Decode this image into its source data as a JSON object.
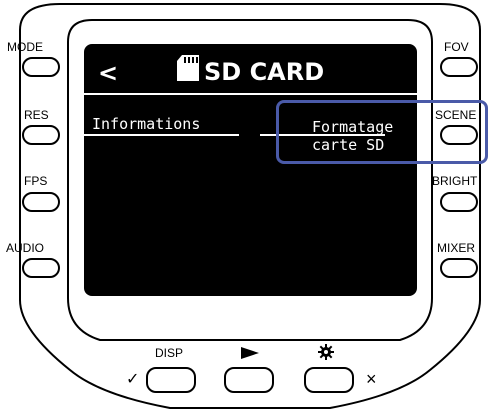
{
  "screen": {
    "back_glyph": "<",
    "title_icon": "sd-card-icon",
    "title": "SD CARD",
    "menu": {
      "informations": "Informations",
      "format_line1": "Formatage",
      "format_line2": "carte SD"
    }
  },
  "side_buttons": {
    "mode": "MODE",
    "res": "RES",
    "fps": "FPS",
    "audio": "AUDIO",
    "fov": "FOV",
    "scene": "SCENE",
    "bright": "BRIGHT",
    "mixer": "MIXER"
  },
  "bottom_buttons": {
    "disp": "DISP",
    "play_icon": "play-icon",
    "gear_icon": "gear-icon",
    "check": "✓",
    "cross": "×"
  },
  "colors": {
    "screen_bg": "#000000",
    "screen_text": "#ffffff",
    "highlight": "#4a5aa8"
  }
}
